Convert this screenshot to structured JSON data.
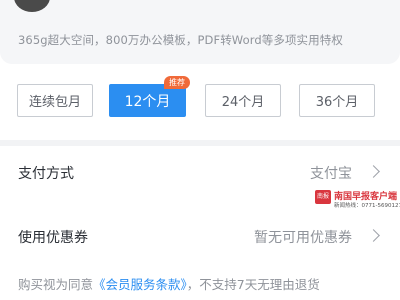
{
  "membership": {
    "benefits_text": "365g超大空间，800万办公模板，PDF转Word等多项实用特权"
  },
  "plans": [
    {
      "label": "连续包月",
      "selected": false
    },
    {
      "label": "12个月",
      "selected": true,
      "badge": "推荐"
    },
    {
      "label": "24个月",
      "selected": false
    },
    {
      "label": "36个月",
      "selected": false
    }
  ],
  "payment": {
    "label": "支付方式",
    "value": "支付宝"
  },
  "coupon": {
    "label": "使用优惠券",
    "value": "暂无可用优惠券"
  },
  "terms": {
    "prefix": "购买视为同意",
    "link": "《会员服务条款》",
    "suffix": "，不支持7天无理由退货"
  },
  "watermark": {
    "logo_text": "南报",
    "title": "南国早报客户端",
    "subtitle": "新闻热线：0771-5690127"
  },
  "colors": {
    "accent": "#2b8ef1",
    "badge": "#f06a3a",
    "watermark": "#d9363e"
  }
}
